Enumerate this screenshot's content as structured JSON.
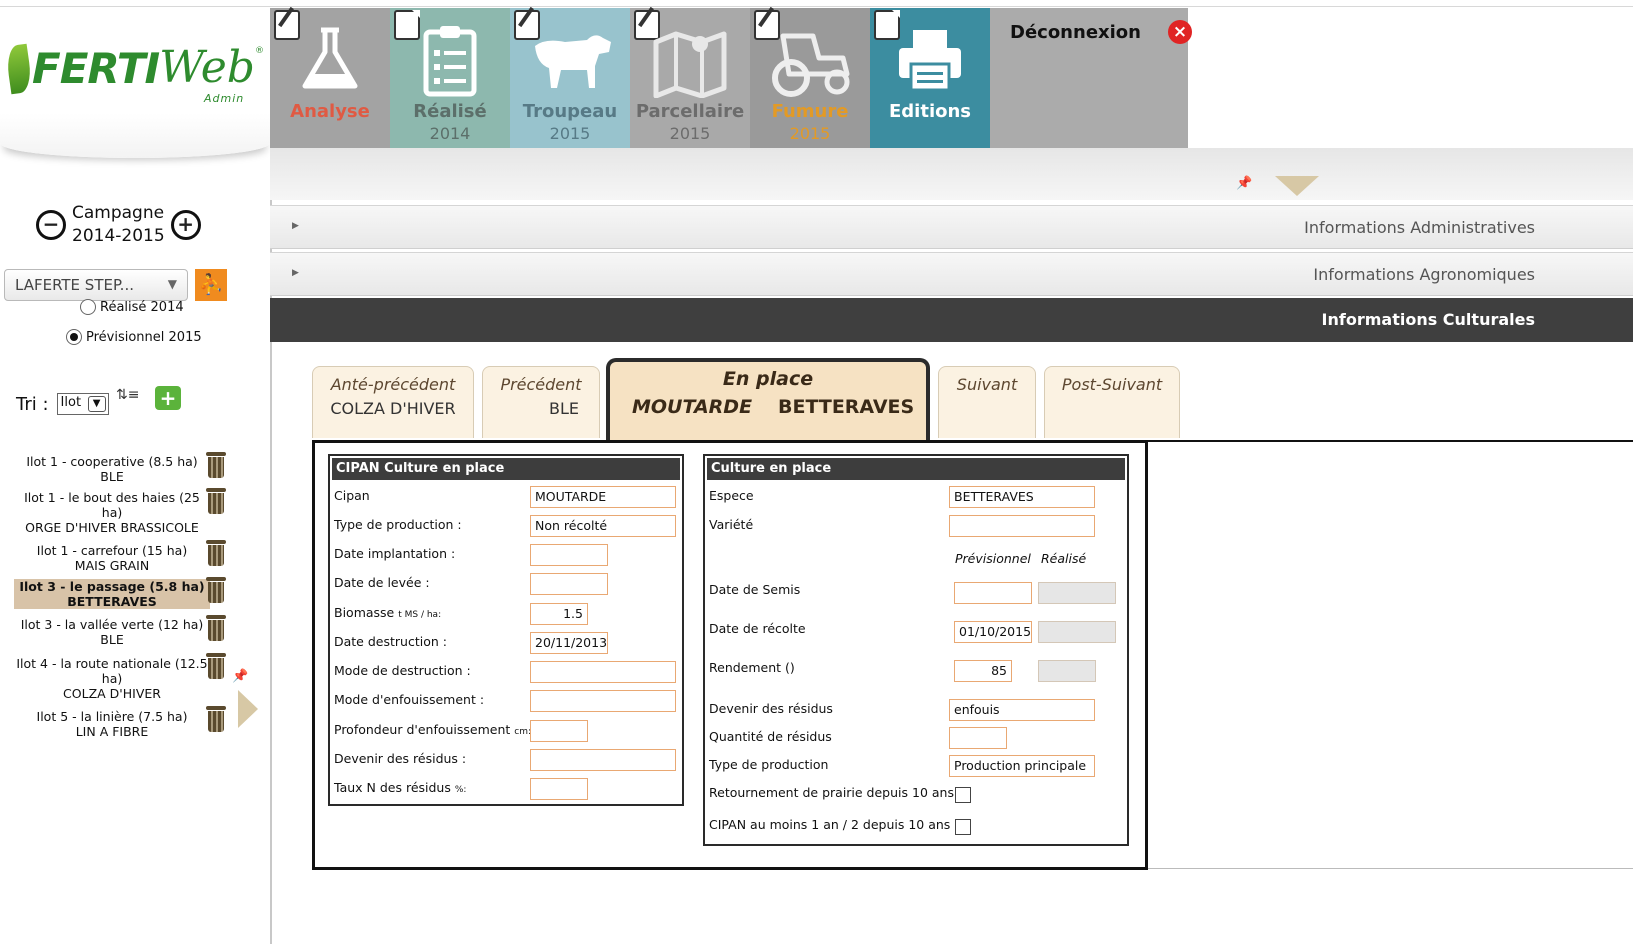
{
  "logo": {
    "ferti": "FERTI",
    "web": "Web",
    "reg": "®",
    "admin": "Admin"
  },
  "nav": [
    {
      "label": "Analyse",
      "year": "",
      "icon": "flask-icon"
    },
    {
      "label": "Réalisé",
      "year": "2014",
      "icon": "clipboard-icon"
    },
    {
      "label": "Troupeau",
      "year": "2015",
      "icon": "cow-icon"
    },
    {
      "label": "Parcellaire",
      "year": "2015",
      "icon": "map-icon"
    },
    {
      "label": "Fumure",
      "year": "2015",
      "icon": "tractor-icon"
    },
    {
      "label": "Editions",
      "year": "",
      "icon": "printer-icon"
    }
  ],
  "deconnexion": {
    "label": "Déconnexion",
    "icon": "close-circle-icon"
  },
  "sidebar": {
    "campagne_label": "Campagne",
    "campagne_value": "2014-2015",
    "farm": "LAFERTE STEP...",
    "radio_realise": "Réalisé 2014",
    "radio_prev": "Prévisionnel 2015",
    "tri_label": "Tri :",
    "tri_value": "Ilot",
    "ilots": [
      {
        "name": "Ilot 1 - cooperative (8.5 ha)",
        "crop": "BLE"
      },
      {
        "name": "Ilot 1 - le bout des haies (25 ha)",
        "crop": "ORGE D'HIVER BRASSICOLE"
      },
      {
        "name": "Ilot 1 - carrefour (15 ha)",
        "crop": "MAIS GRAIN"
      },
      {
        "name": "Ilot 3 - le passage (5.8 ha)",
        "crop": "BETTERAVES"
      },
      {
        "name": "Ilot 3 - la vallée verte (12 ha)",
        "crop": "BLE"
      },
      {
        "name": "Ilot 4 - la route nationale (12.5 ha)",
        "crop": "COLZA D'HIVER"
      },
      {
        "name": "Ilot 5 - la linière (7.5 ha)",
        "crop": "LIN A FIBRE"
      }
    ]
  },
  "accordion": {
    "admin": "Informations Administratives",
    "agro": "Informations Agronomiques",
    "cult": "Informations Culturales"
  },
  "culture_tabs": {
    "ante_label": "Anté-précédent",
    "ante_value": "COLZA D'HIVER",
    "prec_label": "Précédent",
    "prec_value": "BLE",
    "place_label": "En place",
    "place_cipan": "MOUTARDE",
    "place_crop": "BETTERAVES",
    "suiv_label": "Suivant",
    "post_label": "Post-Suivant"
  },
  "cipan": {
    "title": "CIPAN Culture en place",
    "cipan_label": "Cipan",
    "cipan_value": "MOUTARDE",
    "type_label": "Type de production :",
    "type_value": "Non récolté",
    "implant_label": "Date implantation :",
    "levee_label": "Date de levée :",
    "biomasse_label": "Biomasse",
    "biomasse_unit": "t MS / ha:",
    "biomasse_value": "1.5",
    "destruction_label": "Date destruction :",
    "destruction_value": "20/11/2013",
    "mode_dest_label": "Mode de destruction :",
    "mode_enf_label": "Mode d'enfouissement :",
    "prof_label": "Profondeur d'enfouissement",
    "prof_unit": "cm:",
    "devenir_label": "Devenir des résidus :",
    "taux_label": "Taux N des résidus",
    "taux_unit": "%:"
  },
  "culture": {
    "title": "Culture en place",
    "espece_label": "Espece",
    "espece_value": "BETTERAVES",
    "variete_label": "Variété",
    "prev_col": "Prévisionnel",
    "real_col": "Réalisé",
    "semis_label": "Date de Semis",
    "recolte_label": "Date de récolte",
    "recolte_value": "01/10/2015",
    "rendement_label": "Rendement ()",
    "rendement_value": "85",
    "devenir_label": "Devenir des résidus",
    "devenir_value": "enfouis",
    "quantite_label": "Quantité de résidus",
    "type_label": "Type de production",
    "type_value": "Production principale",
    "retournement_label": "Retournement de prairie depuis 10 ans",
    "cipan_label": "CIPAN au moins 1 an / 2 depuis 10 ans"
  },
  "colors": {
    "accent": "#3c8da0",
    "dark_header": "#3f3f3f",
    "tab_active": "#f6e2c3",
    "input_border": "#e9a873"
  }
}
